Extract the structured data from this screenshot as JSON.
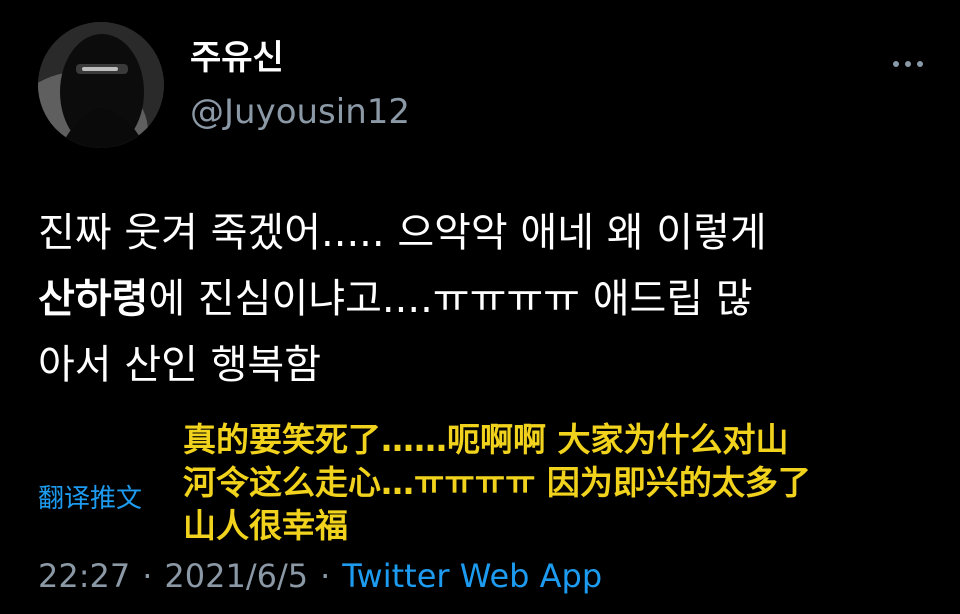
{
  "user": {
    "display_name": "주유신",
    "handle": "@Juyousin12",
    "avatar_icon": "masked-face-avatar"
  },
  "more_icon": "ellipsis-icon",
  "tweet": {
    "line1": "진짜 웃겨 죽겠어..... 으악악 애네 왜 이렇게",
    "line2_bold": "산하령",
    "line2_rest": "에 진심이냐고....ㅠㅠㅠㅠ 애드립 많",
    "line3": "아서 산인 행복함"
  },
  "translate_label": "翻译推文",
  "chinese_subtitle": {
    "line1": "真的要笑死了……呃啊啊 大家为什么对山",
    "line2": "河令这么走心…ㅠㅠㅠㅠ 因为即兴的太多了",
    "line3": "山人很幸福"
  },
  "meta": {
    "time": "22:27",
    "separator": "·",
    "date": "2021/6/5",
    "source": "Twitter Web App"
  },
  "colors": {
    "background": "#000000",
    "text": "#ffffff",
    "secondary": "#8b98a5",
    "link": "#1d9bf0",
    "subtitle": "#f1d21c"
  }
}
